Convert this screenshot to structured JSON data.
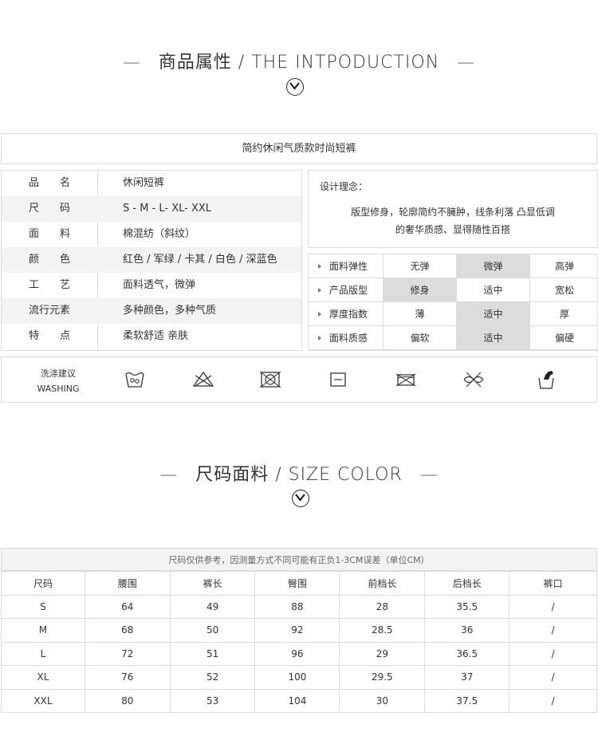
{
  "section1": {
    "title": "商品属性 / THE INTPODUCTION",
    "dash": "—"
  },
  "product_title": "简约休闲气质款时尚短裤",
  "attributes": [
    {
      "key": "品　　名",
      "value": "休闲短裤"
    },
    {
      "key": "尺　　码",
      "value": "S - M - L- XL- XXL"
    },
    {
      "key": "面　　料",
      "value": "棉混纺（斜纹）"
    },
    {
      "key": "颜　　色",
      "value": "红色 / 军绿 / 卡其 / 白色 / 深蓝色"
    },
    {
      "key": "工　　艺",
      "value": "面料透气，微弹"
    },
    {
      "key": "流行元素",
      "value": "多种颜色，多种气质"
    },
    {
      "key": "特　　点",
      "value": "柔软舒适  亲肤"
    }
  ],
  "concept": {
    "label": "设计理念：",
    "line1": "版型修身，轮廓简约不臃肿，线条利落 凸显低调",
    "line2": "的奢华质感、显得随性百搭"
  },
  "grid": [
    {
      "label": "面料弹性",
      "options": [
        "无弹",
        "微弹",
        "高弹"
      ],
      "selected": 1
    },
    {
      "label": "产品版型",
      "options": [
        "修身",
        "适中",
        "宽松"
      ],
      "selected": 0
    },
    {
      "label": "厚度指数",
      "options": [
        "薄",
        "适中",
        "厚"
      ],
      "selected": 1
    },
    {
      "label": "面料质感",
      "options": [
        "偏软",
        "适中",
        "偏硬"
      ],
      "selected": 1
    }
  ],
  "washing": {
    "label_cn": "洗涤建议",
    "label_en": "WASHING",
    "icons": [
      "hand-wash-icon",
      "no-bleach-icon",
      "no-tumble-dry-icon",
      "dry-flat-icon",
      "no-iron-icon",
      "no-dry-clean-icon",
      "no-wring-icon"
    ]
  },
  "section2": {
    "title": "尺码面料 / SIZE COLOR",
    "dash": "—"
  },
  "size_note": "尺码仅供参考，因测量方式不同可能有正负1-3CM误差（单位CM）",
  "size_table": {
    "headers": [
      "尺码",
      "腰围",
      "裤长",
      "臀围",
      "前档长",
      "后档长",
      "裤口"
    ],
    "rows": [
      [
        "S",
        "64",
        "49",
        "88",
        "28",
        "35.5",
        "/"
      ],
      [
        "M",
        "68",
        "50",
        "92",
        "28.5",
        "36",
        "/"
      ],
      [
        "L",
        "72",
        "51",
        "96",
        "29",
        "36.5",
        "/"
      ],
      [
        "XL",
        "76",
        "52",
        "100",
        "29.5",
        "37",
        "/"
      ],
      [
        "XXL",
        "80",
        "53",
        "104",
        "30",
        "37.5",
        "/"
      ]
    ]
  }
}
